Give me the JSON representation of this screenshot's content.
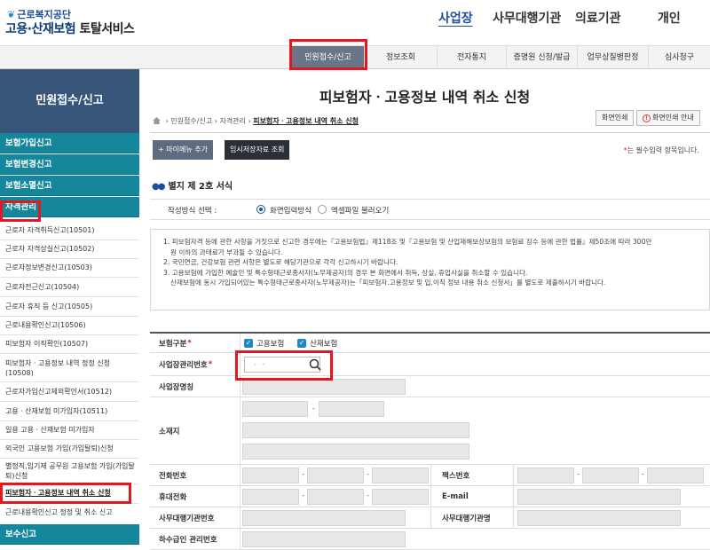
{
  "header": {
    "org_name": "근로복지공단",
    "service_name_prefix": "고용·산재보험",
    "service_name_suffix": "토탈서비스",
    "nav": [
      "사업장",
      "사무대행기관",
      "의료기관",
      "개인"
    ]
  },
  "subnav": {
    "tabs": [
      "민원접수/신고",
      "정보조회",
      "전자통지",
      "증명원 신청/발급",
      "업무상질병판정",
      "심사청구"
    ]
  },
  "sidebar": {
    "title": "민원접수/신고",
    "categories": [
      "보험가입신고",
      "보험변경신고",
      "보험소멸신고",
      "자격관리",
      "보수신고"
    ],
    "items": [
      "근로자 자격취득신고(10501)",
      "근로자 자격상실신고(10502)",
      "근로자정보변경신고(10503)",
      "근로자전근신고(10504)",
      "근로자 휴직 등 신고(10505)",
      "근로내용확인신고(10506)",
      "피보험자 이직확인(10507)",
      "피보험자ㆍ고용정보 내역 정정 신청(10508)",
      "근로자가입신고제외확인서(10512)",
      "고용ㆍ산재보험 미가입자(10511)",
      "일용 고용ㆍ산재보험 미가입자",
      "외국인 고용보험 가입(가입탈퇴)신청",
      "별정직,임기제 공무원 고용보험 가입(가입탈퇴)신청",
      "피보험자ㆍ고용정보 내역 취소 신청",
      "근로내용확인신고 정정 및 취소 신고"
    ]
  },
  "main": {
    "title": "피보험자ㆍ고용정보 내역 취소 신청",
    "breadcrumb": [
      "민원접수/신고",
      "자격관리",
      "피보험자ㆍ고용정보 내역 취소 신청"
    ],
    "print_label": "화면인쇄",
    "print_guide_label": "화면인쇄 안내",
    "add_menu_label": "+ 마이메뉴 추가",
    "temp_save_label": "임시저장자료 조회",
    "required_note": "는 필수입력 항목입니다.",
    "section_title": "별지 제 2호 서식",
    "write_method_label": "작성방식 선택 :",
    "write_method_options": [
      "화면입력방식",
      "엑셀파일 불러오기"
    ],
    "notice": [
      "1. 피보험자격 등에 관한 사항을 거짓으로 신고한 경우에는『고용보험법』제118조 및『고용보험 및 산업재해보상보험의 보험료 징수 등에 관한 법률』제50조에 따라 300만",
      "원 이하의 과태료가 부과될 수 있습니다.",
      "2. 국민연금, 건강보험 관련 사항은 별도로 해당기관으로 각각 신고하시기 바랍니다.",
      "3. 고용보험에 가입한 예술인 및 특수형태근로종사자(노무제공자)의 경우 본 화면에서 취득, 상실, 휴업사실을 취소할 수 있습니다.",
      "산재보험에 동시 가입되어있는 특수형태근로종사자(노무제공자)는「피보험자.고용정보 및 입.이직 정보 내용 취소 신청서」를 별도로 제출하시기 바랍니다."
    ],
    "form": {
      "insurance_type_label": "보험구분",
      "insurance_options": [
        "고용보험",
        "산재보험"
      ],
      "workplace_no_label": "사업장관리번호",
      "workplace_no_placeholder": "- -",
      "workplace_name_label": "사업장명칭",
      "address_label": "소재지",
      "phone_label": "전화번호",
      "fax_label": "팩스번호",
      "mobile_label": "휴대전화",
      "email_label": "E-mail",
      "agency_no_label": "사무대행기관번호",
      "agency_name_label": "사무대행기관명",
      "subcontractor_label": "하수급인 관리번호"
    }
  },
  "colors": {
    "sidebar_header": "#38557a",
    "sidebar_category": "#15879d",
    "accent_blue": "#1d4fa0",
    "highlight_red": "#e4161f"
  }
}
